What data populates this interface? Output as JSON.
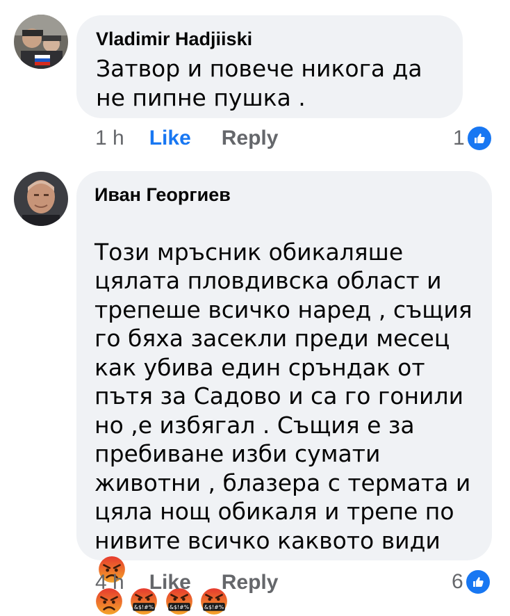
{
  "comments": [
    {
      "author": "Vladimir Hadjiiski",
      "text": "Затвор и повече никога да не пипне пушка .",
      "time": "1 h",
      "like_label": "Like",
      "reply_label": "Reply",
      "reaction_count": "1",
      "reaction_icon": "like-thumb-icon"
    },
    {
      "author": "Иван Георгиев",
      "text": "Този мръсник обикаляше цялата пловдивска област и трепеше всичко наред , същия го бяха засекли преди месец как убива един сръндак  от пътя за Садово и са го гонили но ,е избягал . Същия е за пребиване изби сумати животни , блазера с термата и цяла нощ обикаля и трепе по нивите всичко каквото види",
      "emojis": [
        "angry-face-icon",
        "angry-face-icon",
        "cursing-face-icon",
        "cursing-face-icon",
        "cursing-face-icon"
      ],
      "emoji_caption": "&$!#%",
      "time": "4 h",
      "like_label": "Like",
      "reply_label": "Reply",
      "reaction_count": "6",
      "reaction_icon": "like-thumb-icon"
    }
  ],
  "colors": {
    "bubble_bg": "#f0f2f5",
    "like_blue": "#1877f2",
    "meta_gray": "#65676b"
  }
}
